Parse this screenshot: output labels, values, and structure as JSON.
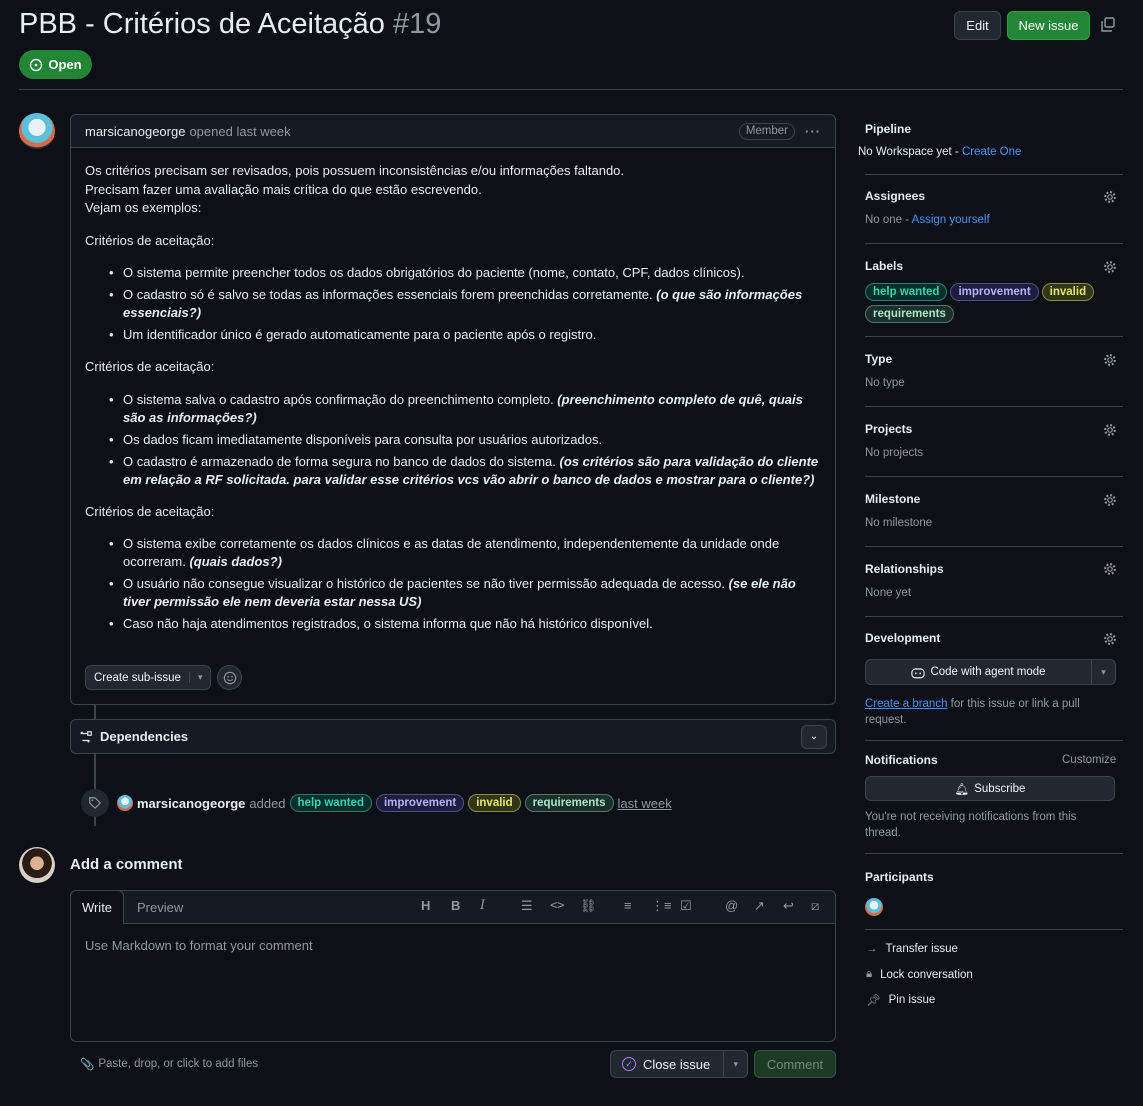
{
  "header": {
    "title": "PBB - Critérios de Aceitação",
    "number": "#19",
    "edit_label": "Edit",
    "new_issue_label": "New issue",
    "status": "Open"
  },
  "comment": {
    "author": "marsicanogeorge",
    "action": "opened last week",
    "role": "Member",
    "intro": [
      "Os critérios precisam ser revisados, pois possuem inconsistências e/ou informações faltando.",
      "Precisam fazer uma avaliação mais crítica do que estão escrevendo.",
      "Vejam os exemplos:"
    ],
    "sections": [
      {
        "heading": "Critérios de aceitação:",
        "items": [
          {
            "text": "O sistema permite preencher todos os dados obrigatórios do paciente (nome, contato, CPF, dados clínicos).",
            "note": ""
          },
          {
            "text": "O cadastro só é salvo se todas as informações essenciais forem preenchidas corretamente. ",
            "note": "(o que são informações essenciais?)"
          },
          {
            "text": "Um identificador único é gerado automaticamente para o paciente após o registro.",
            "note": ""
          }
        ]
      },
      {
        "heading": "Critérios de aceitação:",
        "items": [
          {
            "text": "O sistema salva o cadastro após confirmação do preenchimento completo. ",
            "note": "(preenchimento completo de quê, quais são as informações?)"
          },
          {
            "text": "Os dados ficam imediatamente disponíveis para consulta por usuários autorizados.",
            "note": ""
          },
          {
            "text": "O cadastro é armazenado de forma segura no banco de dados do sistema. ",
            "note": "(os critérios são para validação do cliente em relação a RF solicitada. para validar esse critérios vcs vão abrir o banco de dados e mostrar para o cliente?)"
          }
        ]
      },
      {
        "heading": "Critérios de aceitação:",
        "items": [
          {
            "text": "O sistema exibe corretamente os dados clínicos e as datas de atendimento, independentemente da unidade onde ocorreram. ",
            "note": "(quais dados?)"
          },
          {
            "text": "O usuário não consegue visualizar o histórico de pacientes se não tiver permissão adequada de acesso. ",
            "note": "(se ele não tiver permissão ele nem deveria estar nessa US)"
          },
          {
            "text": "Caso não haja atendimentos registrados, o sistema informa que não há histórico disponível.",
            "note": ""
          }
        ]
      }
    ],
    "create_sub_issue": "Create sub-issue"
  },
  "dependencies": {
    "label": "Dependencies"
  },
  "timeline": {
    "author": "marsicanogeorge",
    "action": "added",
    "labels": [
      "help wanted",
      "improvement",
      "invalid",
      "requirements"
    ],
    "time": "last week"
  },
  "add_comment": {
    "title": "Add a comment",
    "tab_write": "Write",
    "tab_preview": "Preview",
    "placeholder": "Use Markdown to format your comment",
    "attach_hint": "Paste, drop, or click to add files",
    "close_issue": "Close issue",
    "comment_btn": "Comment"
  },
  "sidebar": {
    "pipeline": {
      "title": "Pipeline",
      "text": "No Workspace yet - ",
      "link": "Create One"
    },
    "assignees": {
      "title": "Assignees",
      "text": "No one - ",
      "link": "Assign yourself"
    },
    "labels": {
      "title": "Labels",
      "items": [
        "help wanted",
        "improvement",
        "invalid",
        "requirements"
      ]
    },
    "type": {
      "title": "Type",
      "text": "No type"
    },
    "projects": {
      "title": "Projects",
      "text": "No projects"
    },
    "milestone": {
      "title": "Milestone",
      "text": "No milestone"
    },
    "relationships": {
      "title": "Relationships",
      "text": "None yet"
    },
    "development": {
      "title": "Development",
      "agent_btn": "Code with agent mode",
      "link": "Create a branch",
      "text": " for this issue or link a pull request."
    },
    "notifications": {
      "title": "Notifications",
      "customize": "Customize",
      "subscribe": "Subscribe",
      "text": "You're not receiving notifications from this thread."
    },
    "participants": {
      "title": "Participants"
    },
    "actions": [
      "Transfer issue",
      "Lock conversation",
      "Pin issue"
    ]
  }
}
